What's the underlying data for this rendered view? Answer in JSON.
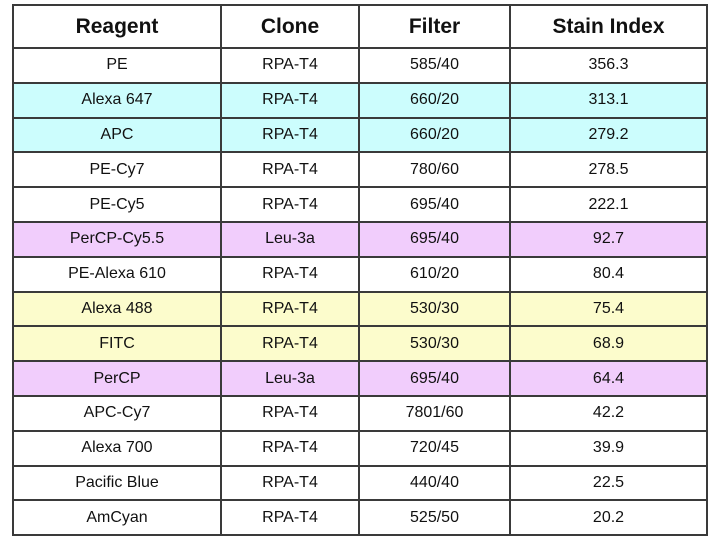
{
  "table": {
    "headers": [
      "Reagent",
      "Clone",
      "Filter",
      "Stain Index"
    ],
    "highlight_colors": {
      "white": "#ffffff",
      "cyan": "#ccfdfd",
      "purple": "#f1cdfc",
      "yellow": "#fcfccc"
    },
    "rows": [
      {
        "reagent": "PE",
        "clone": "RPA-T4",
        "filter": "585/40",
        "stain_index": "356.3",
        "color": "white"
      },
      {
        "reagent": "Alexa 647",
        "clone": "RPA-T4",
        "filter": "660/20",
        "stain_index": "313.1",
        "color": "cyan"
      },
      {
        "reagent": "APC",
        "clone": "RPA-T4",
        "filter": "660/20",
        "stain_index": "279.2",
        "color": "cyan"
      },
      {
        "reagent": "PE-Cy7",
        "clone": "RPA-T4",
        "filter": "780/60",
        "stain_index": "278.5",
        "color": "white"
      },
      {
        "reagent": "PE-Cy5",
        "clone": "RPA-T4",
        "filter": "695/40",
        "stain_index": "222.1",
        "color": "white"
      },
      {
        "reagent": "PerCP-Cy5.5",
        "clone": "Leu-3a",
        "filter": "695/40",
        "stain_index": "92.7",
        "color": "purple"
      },
      {
        "reagent": "PE-Alexa 610",
        "clone": "RPA-T4",
        "filter": "610/20",
        "stain_index": "80.4",
        "color": "white"
      },
      {
        "reagent": "Alexa 488",
        "clone": "RPA-T4",
        "filter": "530/30",
        "stain_index": "75.4",
        "color": "yellow"
      },
      {
        "reagent": "FITC",
        "clone": "RPA-T4",
        "filter": "530/30",
        "stain_index": "68.9",
        "color": "yellow"
      },
      {
        "reagent": "PerCP",
        "clone": "Leu-3a",
        "filter": "695/40",
        "stain_index": "64.4",
        "color": "purple"
      },
      {
        "reagent": "APC-Cy7",
        "clone": "RPA-T4",
        "filter": "7801/60",
        "stain_index": "42.2",
        "color": "white"
      },
      {
        "reagent": "Alexa 700",
        "clone": "RPA-T4",
        "filter": "720/45",
        "stain_index": "39.9",
        "color": "white"
      },
      {
        "reagent": "Pacific Blue",
        "clone": "RPA-T4",
        "filter": "440/40",
        "stain_index": "22.5",
        "color": "white"
      },
      {
        "reagent": "AmCyan",
        "clone": "RPA-T4",
        "filter": "525/50",
        "stain_index": "20.2",
        "color": "white"
      }
    ]
  }
}
